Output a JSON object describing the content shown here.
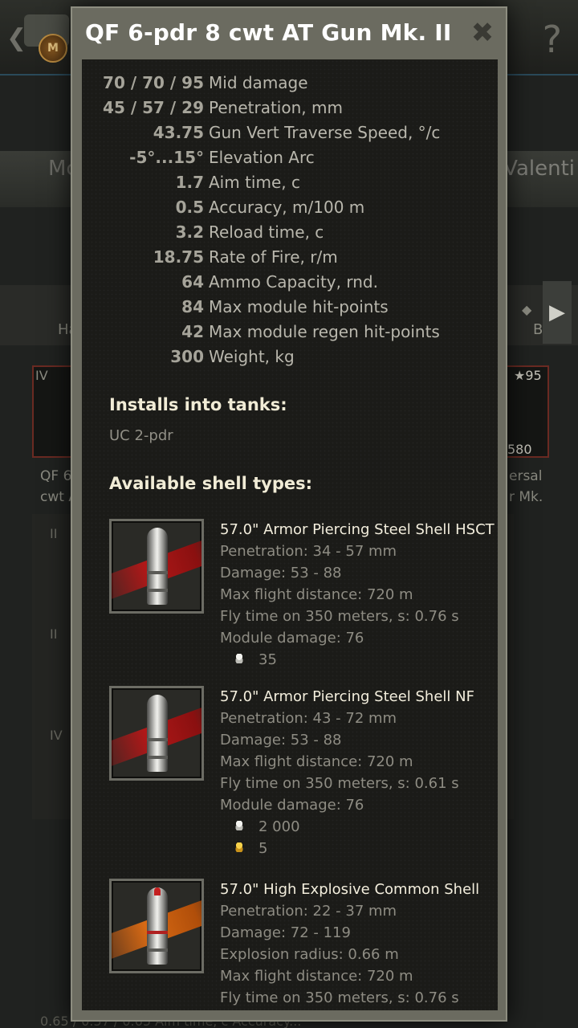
{
  "background": {
    "back_glyph": "❮",
    "medal_letter": "M",
    "help_glyph": "?",
    "tab_left": "Mc",
    "tab_right": "Valenti",
    "strip_left": "Ha",
    "strip_right": "B",
    "arrow_glyph": "▶",
    "card_left_tier": "IV",
    "card_right_stars": "★95",
    "card_right_price": "580",
    "card_left_name_1": "QF 6",
    "card_left_name_2": "cwt A",
    "card_right_name_1": "ersal",
    "card_right_name_2": "r Mk.",
    "list_tier_1": "II",
    "list_tier_2": "II",
    "list_tier_3": "IV",
    "bottom_text": "0.65 / 0.57 / 0.65 Aim time, c  Accuracy..."
  },
  "modal": {
    "title": "QF 6-pdr 8 cwt AT Gun Mk. II",
    "close_glyph": "✖",
    "stats": [
      {
        "value": "70 / 70 / 95",
        "label": "Mid damage"
      },
      {
        "value": "45 / 57 / 29",
        "label": "Penetration, mm"
      },
      {
        "value": "43.75",
        "label": "Gun Vert Traverse Speed, °/c"
      },
      {
        "value": "-5°...15°",
        "label": "Elevation Arc"
      },
      {
        "value": "1.7",
        "label": "Aim time, c"
      },
      {
        "value": "0.5",
        "label": "Accuracy, m/100 m"
      },
      {
        "value": "3.2",
        "label": "Reload time, c"
      },
      {
        "value": "18.75",
        "label": "Rate of Fire, r/m"
      },
      {
        "value": "64",
        "label": "Ammo Capacity, rnd."
      },
      {
        "value": "84",
        "label": "Max module hit-points"
      },
      {
        "value": "42",
        "label": "Max module regen hit-points"
      },
      {
        "value": "300",
        "label": "Weight, kg"
      }
    ],
    "installs_title": "Installs into tanks:",
    "installs_tanks": "UC 2-pdr",
    "shells_title": "Available shell types:",
    "shells": [
      {
        "name": "57.0\" Armor Piercing Steel Shell HSCT",
        "lines": [
          "Penetration: 34 - 57 mm",
          "Damage: 53 - 88",
          "Max flight distance: 720 m",
          "Fly time on 350 meters, s: 0.76 s",
          "Module damage: 76"
        ],
        "price_silver": "35"
      },
      {
        "name": "57.0\" Armor Piercing Steel Shell NF",
        "lines": [
          "Penetration: 43 - 72 mm",
          "Damage: 53 - 88",
          "Max flight distance: 720 m",
          "Fly time on 350 meters, s: 0.61 s",
          "Module damage: 76"
        ],
        "price_silver": "2 000",
        "price_gold": "5"
      },
      {
        "name": "57.0\" High Explosive Common Shell",
        "lines": [
          "Penetration: 22 - 37 mm",
          "Damage: 72 - 119",
          "Explosion radius: 0.66 m",
          "Max flight distance: 720 m",
          "Fly time on 350 meters, s: 0.76 s"
        ]
      }
    ]
  }
}
